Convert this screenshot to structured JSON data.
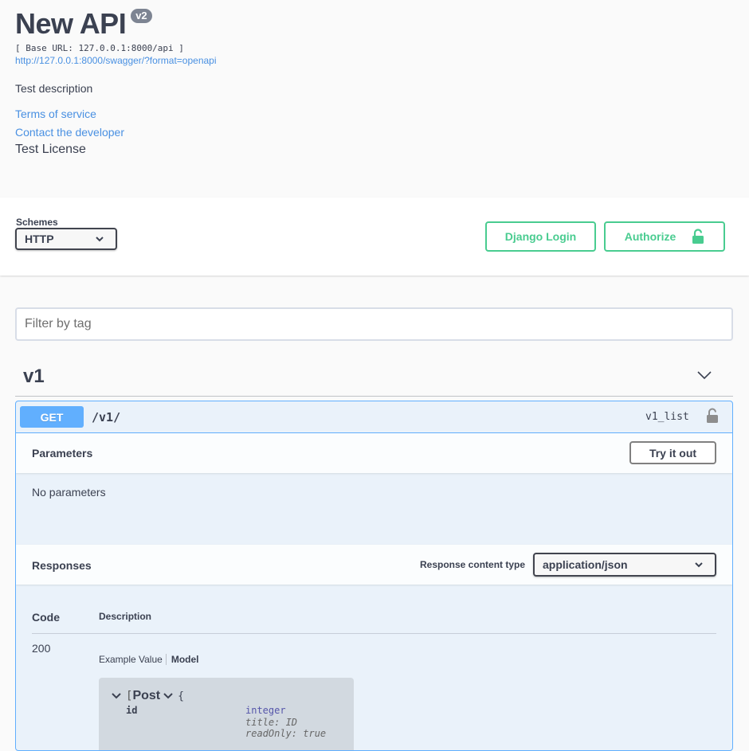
{
  "info": {
    "title": "New API",
    "version": "v2",
    "base_url": "[ Base URL: 127.0.0.1:8000/api ]",
    "spec_url": "http://127.0.0.1:8000/swagger/?format=openapi",
    "description": "Test description",
    "terms": "Terms of service",
    "contact": "Contact the developer",
    "license": "Test License"
  },
  "schemes": {
    "label": "Schemes",
    "selected": "HTTP"
  },
  "buttons": {
    "django_login": "Django Login",
    "authorize": "Authorize"
  },
  "filter": {
    "placeholder": "Filter by tag"
  },
  "tag": {
    "name": "v1"
  },
  "operation": {
    "method": "GET",
    "path": "/v1/",
    "operation_id": "v1_list",
    "parameters_heading": "Parameters",
    "try_label": "Try it out",
    "no_parameters": "No parameters",
    "responses_heading": "Responses",
    "content_type_label": "Response content type",
    "content_type": "application/json",
    "columns": {
      "code": "Code",
      "description": "Description"
    },
    "response": {
      "code": "200",
      "tab_example": "Example Value",
      "tab_model": "Model",
      "model": {
        "bracket": "[",
        "name": "Post",
        "brace": "{",
        "prop_name": "id",
        "prop_type": "integer",
        "prop_title": "title: ID",
        "prop_readonly": "readOnly: true"
      }
    }
  },
  "colors": {
    "accent_green": "#49cc90",
    "get_blue": "#61affe",
    "link_blue": "#4990e2",
    "text": "#3b4151"
  }
}
